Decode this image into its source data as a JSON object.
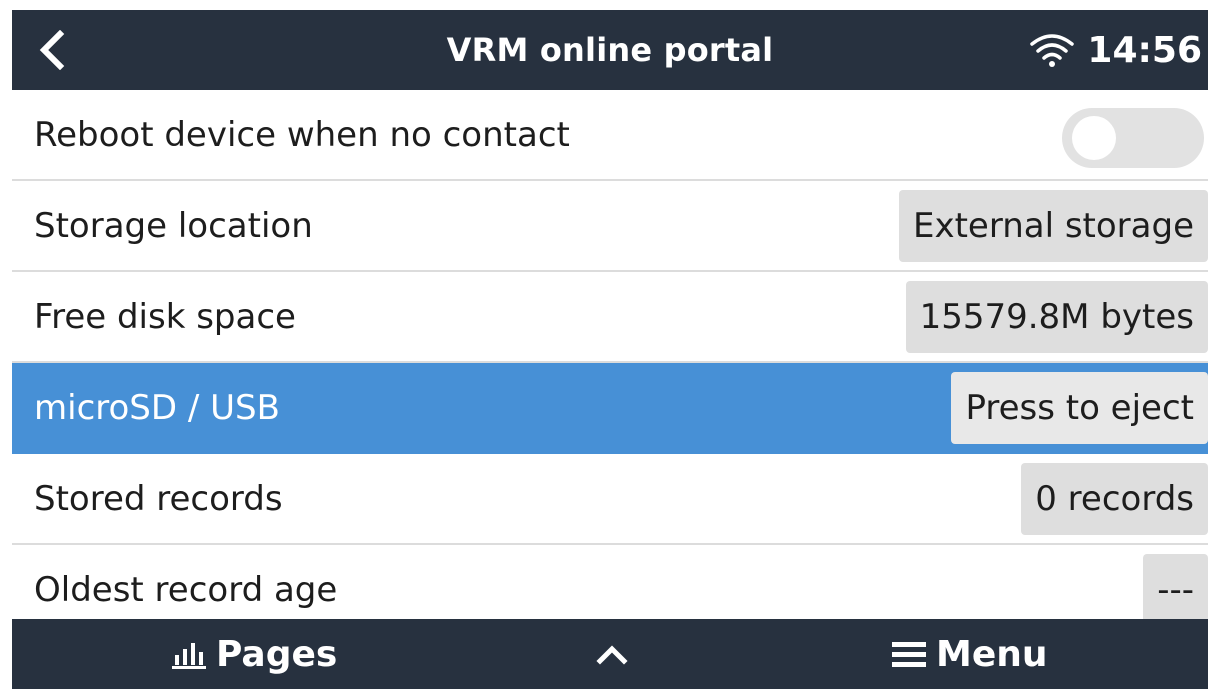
{
  "header": {
    "title": "VRM online portal",
    "time": "14:56",
    "back_icon": "chevron-left-icon",
    "wifi_icon": "wifi-icon"
  },
  "rows": [
    {
      "label": "Reboot device when no contact",
      "control": "toggle",
      "toggle_on": false
    },
    {
      "label": "Storage location",
      "value": "External storage"
    },
    {
      "label": "Free disk space",
      "value": "15579.8M bytes"
    },
    {
      "label": "microSD / USB",
      "value": "Press to eject",
      "selected": true
    },
    {
      "label": "Stored records",
      "value": "0 records"
    },
    {
      "label": "Oldest record age",
      "value": "---"
    }
  ],
  "footer": {
    "pages_label": "Pages",
    "pages_icon": "bar-chart-icon",
    "up_icon": "chevron-up-icon",
    "menu_label": "Menu",
    "menu_icon": "hamburger-menu-icon"
  },
  "colors": {
    "bar_background": "#27313f",
    "selected_row": "#4790d6",
    "value_box": "#dedede"
  }
}
